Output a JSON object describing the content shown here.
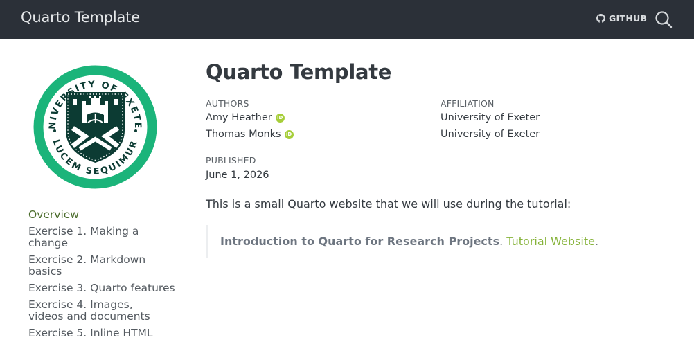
{
  "navbar": {
    "brand": "Quarto Template",
    "github_label": "GITHUB",
    "github_icon": "github-icon",
    "search_icon": "search-icon"
  },
  "sidebar": {
    "logo": {
      "text_top": "UNIVERSITY OF EXETER",
      "text_bottom": "LUCEM SEQUIMUR",
      "color": "#1bb47a"
    },
    "items": [
      {
        "label": "Overview",
        "active": true
      },
      {
        "label": "Exercise 1. Making a change"
      },
      {
        "label": "Exercise 2. Markdown basics"
      },
      {
        "label": "Exercise 3. Quarto features"
      },
      {
        "label": "Exercise 4. Images, videos and documents"
      },
      {
        "label": "Exercise 5. Inline HTML"
      }
    ]
  },
  "main": {
    "title": "Quarto Template",
    "authors_heading": "AUTHORS",
    "affiliation_heading": "AFFILIATION",
    "authors": [
      {
        "name": "Amy Heather",
        "affiliation": "University of Exeter"
      },
      {
        "name": "Thomas Monks",
        "affiliation": "University of Exeter"
      }
    ],
    "published_heading": "PUBLISHED",
    "published_date": "June 1, 2026",
    "intro": "This is a small Quarto website that we will use during the tutorial:",
    "callout": {
      "bold": "Introduction to Quarto for Research Projects",
      "sep": ". ",
      "link": "Tutorial Website",
      "end": "."
    }
  },
  "colors": {
    "navbar_bg": "#2b3038",
    "active_link": "#4a6b2a",
    "link": "#86b33a",
    "orcid": "#a6ce39"
  }
}
